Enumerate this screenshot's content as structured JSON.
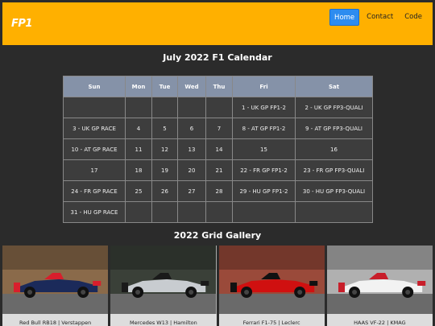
{
  "header": {
    "logo": "FP1",
    "nav": [
      {
        "label": "Home",
        "active": true
      },
      {
        "label": "Contact",
        "active": false
      },
      {
        "label": "Code",
        "active": false
      }
    ]
  },
  "calendar": {
    "title": "July 2022 F1 Calendar",
    "columns": [
      "Sun",
      "Mon",
      "Tue",
      "Wed",
      "Thu",
      "Fri",
      "Sat"
    ],
    "rows": [
      [
        "",
        "",
        "",
        "",
        "",
        "1 - UK GP FP1-2",
        "2 - UK GP FP3-QUALI"
      ],
      [
        "3 - UK GP RACE",
        "4",
        "5",
        "6",
        "7",
        "8 - AT GP FP1-2",
        "9 - AT GP FP3-QUALI"
      ],
      [
        "10 - AT GP RACE",
        "11",
        "12",
        "13",
        "14",
        "15",
        "16"
      ],
      [
        "17",
        "18",
        "19",
        "20",
        "21",
        "22 - FR GP FP1-2",
        "23 - FR GP FP3-QUALI"
      ],
      [
        "24 - FR GP RACE",
        "25",
        "26",
        "27",
        "28",
        "29 - HU GP FP1-2",
        "30 - HU GP FP3-QUALI"
      ],
      [
        "31 - HU GP RACE",
        "",
        "",
        "",
        "",
        "",
        ""
      ]
    ]
  },
  "gallery": {
    "title": "2022 Grid Gallery",
    "cards": [
      {
        "caption": "Red Bull RB18 | Verstappen",
        "car_color": "#1b2a5a",
        "accent": "#d81e2c",
        "bg": "#8a6a4a"
      },
      {
        "caption": "Mercedes W13 | Hamilton",
        "car_color": "#c8ccd0",
        "accent": "#1a1a1a",
        "bg": "#3a4038"
      },
      {
        "caption": "Ferrari F1-75 | Leclerc",
        "car_color": "#d01010",
        "accent": "#111111",
        "bg": "#9a4a3a"
      },
      {
        "caption": "HAAS VF-22 | KMAG",
        "car_color": "#f2f2f2",
        "accent": "#c81e2a",
        "bg": "#b0b0b0"
      }
    ]
  }
}
